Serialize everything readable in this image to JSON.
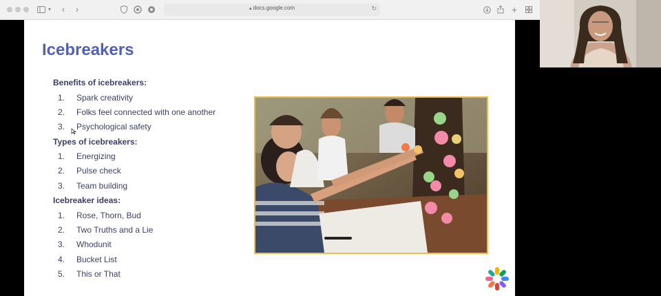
{
  "browser": {
    "url": "docs.google.com",
    "icons": [
      "sidebar-icon",
      "chevron-down-icon",
      "back-icon",
      "forward-icon",
      "shield-icon",
      "privacy-report-icon",
      "extension-icon",
      "lock-icon",
      "reload-icon",
      "download-icon",
      "share-icon",
      "new-tab-icon",
      "tab-overview-icon"
    ]
  },
  "slide": {
    "title": "Icebreakers",
    "sections": [
      {
        "heading": "Benefits of icebreakers:",
        "items": [
          {
            "num": "1.",
            "text": "Spark creativity"
          },
          {
            "num": "2.",
            "text": "Folks feel connected with one another"
          },
          {
            "num": "3.",
            "text": "Psychological safety"
          }
        ]
      },
      {
        "heading": "Types of icebreakers:",
        "items": [
          {
            "num": "1.",
            "text": "Energizing"
          },
          {
            "num": "2.",
            "text": "Pulse check"
          },
          {
            "num": "3.",
            "text": "Team building"
          }
        ]
      },
      {
        "heading": "Icebreaker ideas:",
        "items": [
          {
            "num": "1.",
            "text": "Rose, Thorn, Bud"
          },
          {
            "num": "2.",
            "text": "Two Truths and a Lie"
          },
          {
            "num": "3.",
            "text": "Whodunit"
          },
          {
            "num": "4.",
            "text": "Bucket List"
          },
          {
            "num": "5.",
            "text": "This or That"
          }
        ]
      }
    ],
    "colors": {
      "title": "#5361b3",
      "body": "#3b3f66",
      "photo_border": "#e6bf4f"
    }
  }
}
